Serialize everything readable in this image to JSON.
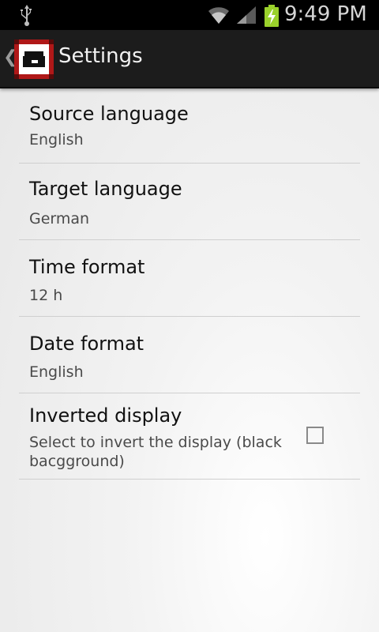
{
  "status_bar": {
    "time": "9:49 PM",
    "icons": [
      "usb-icon",
      "wifi-icon",
      "signal-icon",
      "battery-charging-icon"
    ]
  },
  "action_bar": {
    "title": "Settings",
    "up_glyph": "❮"
  },
  "colors": {
    "action_bar_bg": "#1c1c1c",
    "status_bar_bg": "#000000",
    "app_icon_frame": "#b01818"
  },
  "settings": [
    {
      "title": "Source language",
      "summary": "English"
    },
    {
      "title": "Target language",
      "summary": "German"
    },
    {
      "title": "Time format",
      "summary": "12 h"
    },
    {
      "title": "Date format",
      "summary": "English"
    },
    {
      "title": "Inverted display",
      "summary": "Select to invert the display (black bacgground)",
      "checked": false
    }
  ]
}
